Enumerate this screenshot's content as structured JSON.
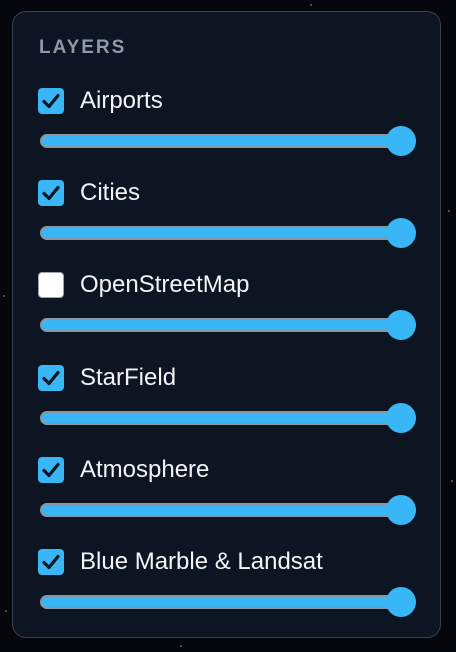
{
  "panel": {
    "title": "LAYERS"
  },
  "layers": [
    {
      "label": "Airports",
      "checked": true,
      "opacity": 1.0
    },
    {
      "label": "Cities",
      "checked": true,
      "opacity": 1.0
    },
    {
      "label": "OpenStreetMap",
      "checked": false,
      "opacity": 1.0
    },
    {
      "label": "StarField",
      "checked": true,
      "opacity": 1.0
    },
    {
      "label": "Atmosphere",
      "checked": true,
      "opacity": 1.0
    },
    {
      "label": "Blue Marble & Landsat",
      "checked": true,
      "opacity": 1.0
    }
  ],
  "colors": {
    "accent": "#38b6f5",
    "panel_bg": "#0d1522",
    "title": "#8f99ab",
    "label": "#f2f4f7"
  },
  "icons": {
    "checked": "checkmark-icon"
  }
}
